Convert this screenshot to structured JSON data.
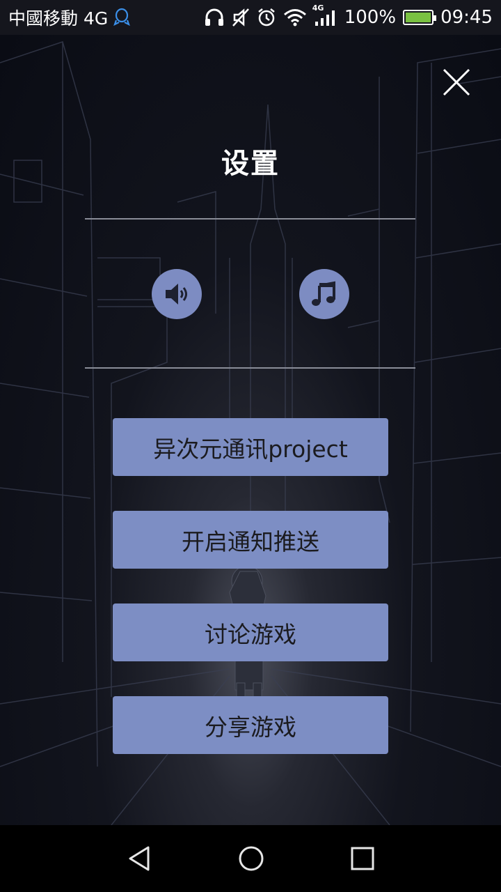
{
  "status_bar": {
    "carrier": "中國移動 4G",
    "battery": "100%",
    "time": "09:45",
    "network_badge": "4G",
    "icons": [
      "qq-icon",
      "headphones-icon",
      "mute-icon",
      "alarm-icon",
      "wifi-icon",
      "signal-icon",
      "battery-icon"
    ],
    "battery_fill": 1.0
  },
  "settings": {
    "title": "设置",
    "sound_toggle_icon": "speaker-icon",
    "music_toggle_icon": "music-note-icon",
    "close_icon": "close-icon",
    "accent_color": "#7d8ec4"
  },
  "menu": {
    "items": [
      {
        "label": "异次元通讯project"
      },
      {
        "label": "开启通知推送"
      },
      {
        "label": "讨论游戏"
      },
      {
        "label": "分享游戏"
      }
    ]
  },
  "nav_bar": {
    "icons": [
      "back-icon",
      "home-icon",
      "recent-apps-icon"
    ]
  }
}
